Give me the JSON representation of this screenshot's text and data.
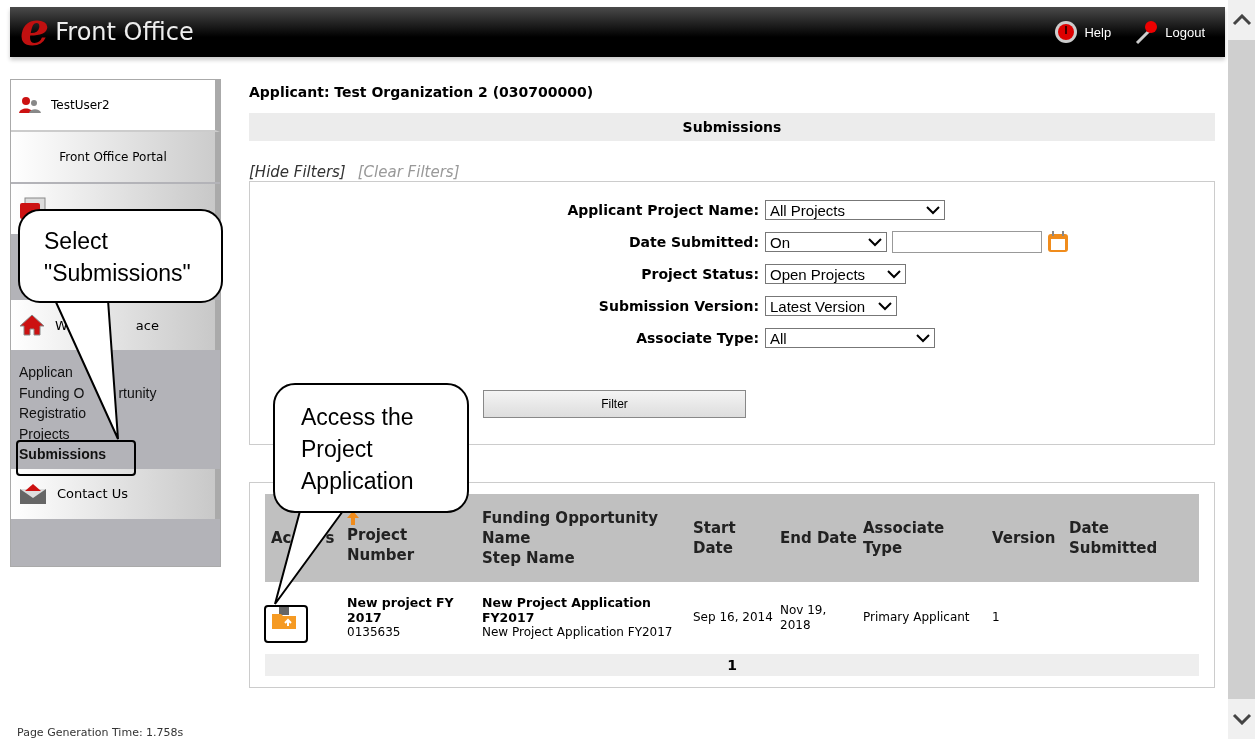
{
  "header": {
    "logo_letter": "e",
    "title": "Front Office",
    "actions": [
      {
        "kind": "help",
        "label": "Help"
      },
      {
        "kind": "logout",
        "label": "Logout"
      }
    ]
  },
  "sidebar": {
    "user": "TestUser2",
    "portal": "Front Office Portal",
    "items": [
      {
        "kind": "profile"
      },
      {
        "kind": "workspace",
        "label_parts": [
          "W",
          "ace"
        ],
        "children": [
          {
            "lines": [
              [
                "Applican"
              ]
            ],
            "selected": false
          },
          {
            "lines": [
              [
                "Funding O",
                "rtunity"
              ],
              [
                "Registratio"
              ]
            ],
            "selected": false
          },
          {
            "lines": [
              [
                "Projects"
              ]
            ],
            "selected": false
          },
          {
            "lines": [
              [
                "Submissions"
              ]
            ],
            "selected": true
          }
        ]
      },
      {
        "kind": "contact",
        "label_parts": [
          "Contact Us"
        ]
      }
    ]
  },
  "main": {
    "applicant": "Applicant: Test Organization 2 (030700000)",
    "section_title": "Submissions",
    "filter_links": [
      {
        "label": "[Hide Filters]",
        "disabled": false
      },
      {
        "label": "[Clear Filters]",
        "disabled": true
      }
    ],
    "filters": [
      {
        "kind": "select",
        "label": "Applicant Project Name:",
        "value": "All Projects"
      },
      {
        "kind": "date",
        "label": "Date Submitted:",
        "value": "On"
      },
      {
        "kind": "select",
        "label": "Project Status:",
        "value": "Open Projects"
      },
      {
        "kind": "select",
        "label": "Submission Version:",
        "value": "Latest Version"
      },
      {
        "kind": "select",
        "label": "Associate Type:",
        "value": "All"
      }
    ],
    "filter_button": "Filter",
    "table": {
      "columns": [
        {
          "parts": [
            "Ac",
            "s"
          ],
          "sorted": false
        },
        {
          "lines": [
            "Project Number"
          ],
          "sorted": true
        },
        {
          "lines": [
            "Funding Opportunity Name",
            "Step Name"
          ],
          "sorted": false
        },
        {
          "lines": [
            "Start Date"
          ],
          "sorted": false
        },
        {
          "lines": [
            "End Date"
          ],
          "sorted": false
        },
        {
          "lines": [
            "Associate Type"
          ],
          "sorted": false
        },
        {
          "lines": [
            "Version"
          ],
          "sorted": false
        },
        {
          "lines": [
            "Date Submitted"
          ],
          "sorted": false
        }
      ],
      "rows": [
        {
          "project_name": "New project FY 2017",
          "project_number": "0135635",
          "funding_name": "New Project Application FY2017",
          "step_name": "New Project Application FY2017",
          "start_date": "Sep 16, 2014",
          "end_date": "Nov 19, 2018",
          "associate_type": "Primary Applicant",
          "version": "1"
        }
      ],
      "pages": [
        {
          "label": "1",
          "selected": true
        }
      ]
    }
  },
  "footer": {
    "generation_time": "Page Generation Time: 1.758s"
  },
  "callouts": [
    {
      "kind": "sidebar",
      "text": "Select \"Submissions\""
    },
    {
      "kind": "action",
      "text": "Access the Project Application"
    }
  ]
}
